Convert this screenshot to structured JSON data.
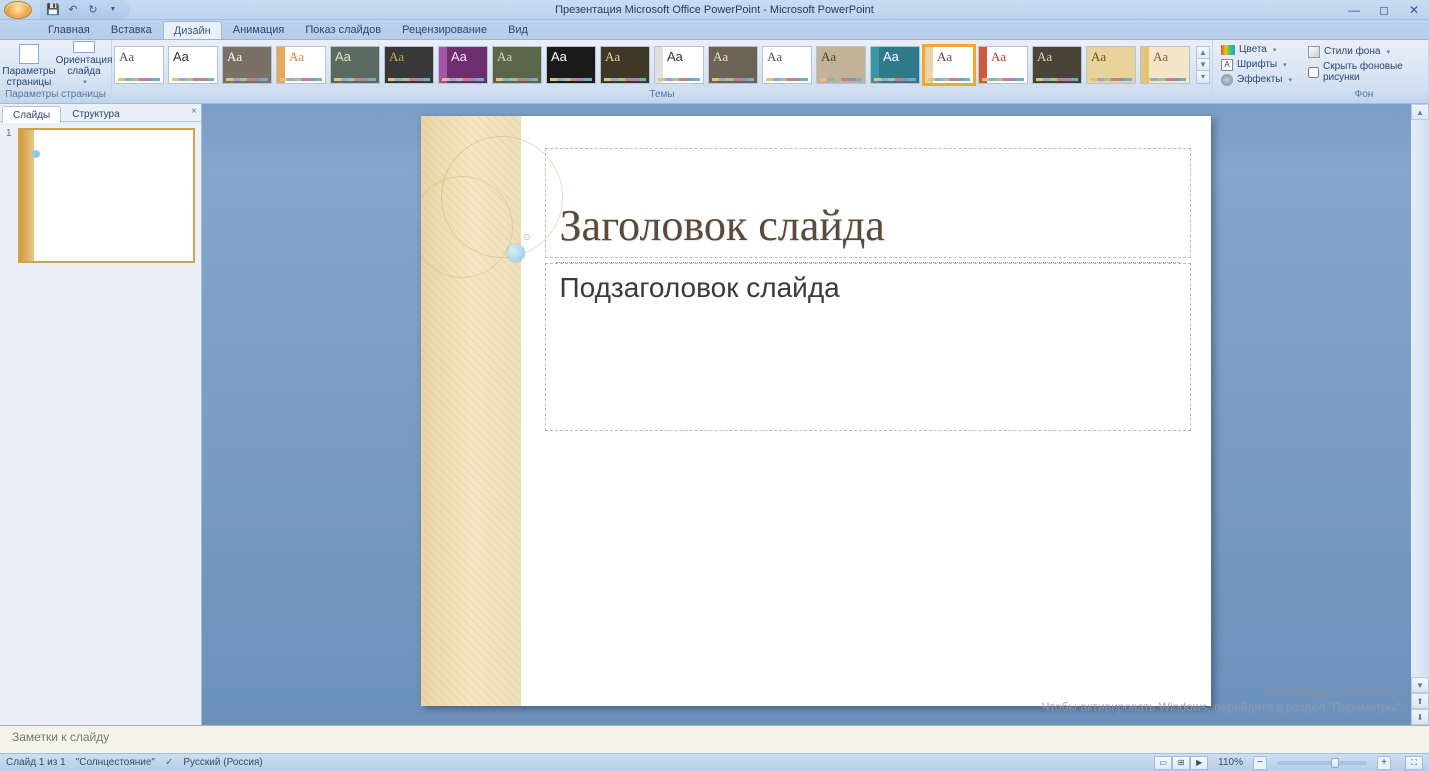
{
  "title": "Презентация Microsoft Office PowerPoint - Microsoft PowerPoint",
  "ribbon_tabs": {
    "home": "Главная",
    "insert": "Вставка",
    "design": "Дизайн",
    "animation": "Анимация",
    "slideshow": "Показ слайдов",
    "review": "Рецензирование",
    "view": "Вид"
  },
  "ribbon": {
    "page_setup_group": "Параметры страницы",
    "page_setup_btn": "Параметры страницы",
    "orientation_btn": "Ориентация слайда",
    "themes_group": "Темы",
    "colors_btn": "Цвета",
    "fonts_btn": "Шрифты",
    "effects_btn": "Эффекты",
    "styles_btn": "Стили фона",
    "hide_bg_chk": "Скрыть фоновые рисунки",
    "background_group": "Фон"
  },
  "themes": [
    {
      "bg": "#ffffff",
      "fg": "#555",
      "stripe": false,
      "serif": true,
      "selected": false
    },
    {
      "bg": "#ffffff",
      "fg": "#333",
      "stripe": false,
      "serif": false,
      "selected": false
    },
    {
      "bg": "#7a7065",
      "fg": "#fff",
      "stripe": false,
      "serif": true,
      "selected": false
    },
    {
      "bg": "#ffffff",
      "fg": "#d8833c",
      "stripe": "#e8a85d",
      "serif": true,
      "selected": false
    },
    {
      "bg": "#5b6a60",
      "fg": "#e6e0c0",
      "stripe": false,
      "serif": false,
      "selected": false
    },
    {
      "bg": "#383838",
      "fg": "#d9a34a",
      "stripe": false,
      "serif": true,
      "selected": false
    },
    {
      "bg": "#6e2d6e",
      "fg": "#f0e6f9",
      "stripe": "#a454a4",
      "serif": false,
      "selected": false
    },
    {
      "bg": "#5a6648",
      "fg": "#d7dcc4",
      "stripe": false,
      "serif": true,
      "selected": false
    },
    {
      "bg": "#1a1a1a",
      "fg": "#ffffff",
      "stripe": false,
      "serif": false,
      "selected": false
    },
    {
      "bg": "#403826",
      "fg": "#e6d5a1",
      "stripe": false,
      "serif": true,
      "selected": false
    },
    {
      "bg": "#ffffff",
      "fg": "#333",
      "stripe": "#e0e0e0",
      "serif": false,
      "selected": false
    },
    {
      "bg": "#6c6354",
      "fg": "#eee3c8",
      "stripe": false,
      "serif": true,
      "selected": false
    },
    {
      "bg": "#ffffff",
      "fg": "#555",
      "stripe": false,
      "serif": true,
      "selected": false
    },
    {
      "bg": "#c2b398",
      "fg": "#4a3f2e",
      "stripe": false,
      "serif": true,
      "selected": false
    },
    {
      "bg": "#2d7a8a",
      "fg": "#fff",
      "stripe": "#3a95a6",
      "serif": false,
      "selected": false
    },
    {
      "bg": "#ffffff",
      "fg": "#5a4a3a",
      "stripe": "#e9d5a5",
      "serif": true,
      "selected": true
    },
    {
      "bg": "#ffffff",
      "fg": "#c0392b",
      "stripe": "#d0583e",
      "serif": true,
      "selected": false
    },
    {
      "bg": "#4a4338",
      "fg": "#e0d5b8",
      "stripe": false,
      "serif": true,
      "selected": false
    },
    {
      "bg": "#ead39a",
      "fg": "#6a4a1e",
      "stripe": false,
      "serif": true,
      "selected": false
    },
    {
      "bg": "#f4e6c8",
      "fg": "#8a5a2a",
      "stripe": "#e5c478",
      "serif": true,
      "selected": false
    }
  ],
  "side_panel": {
    "tab_slides": "Слайды",
    "tab_outline": "Структура",
    "slide_num": "1"
  },
  "slide": {
    "title": "Заголовок слайда",
    "subtitle": "Подзаголовок слайда"
  },
  "watermark": {
    "line1": "Активация Windows",
    "line2": "Чтобы активировать Windows, перейдите в раздел \"Параметры\"."
  },
  "notes_placeholder": "Заметки к слайду",
  "status": {
    "slide_info": "Слайд 1 из 1",
    "theme_name": "\"Солнцестояние\"",
    "language": "Русский (Россия)",
    "zoom": "110%"
  }
}
